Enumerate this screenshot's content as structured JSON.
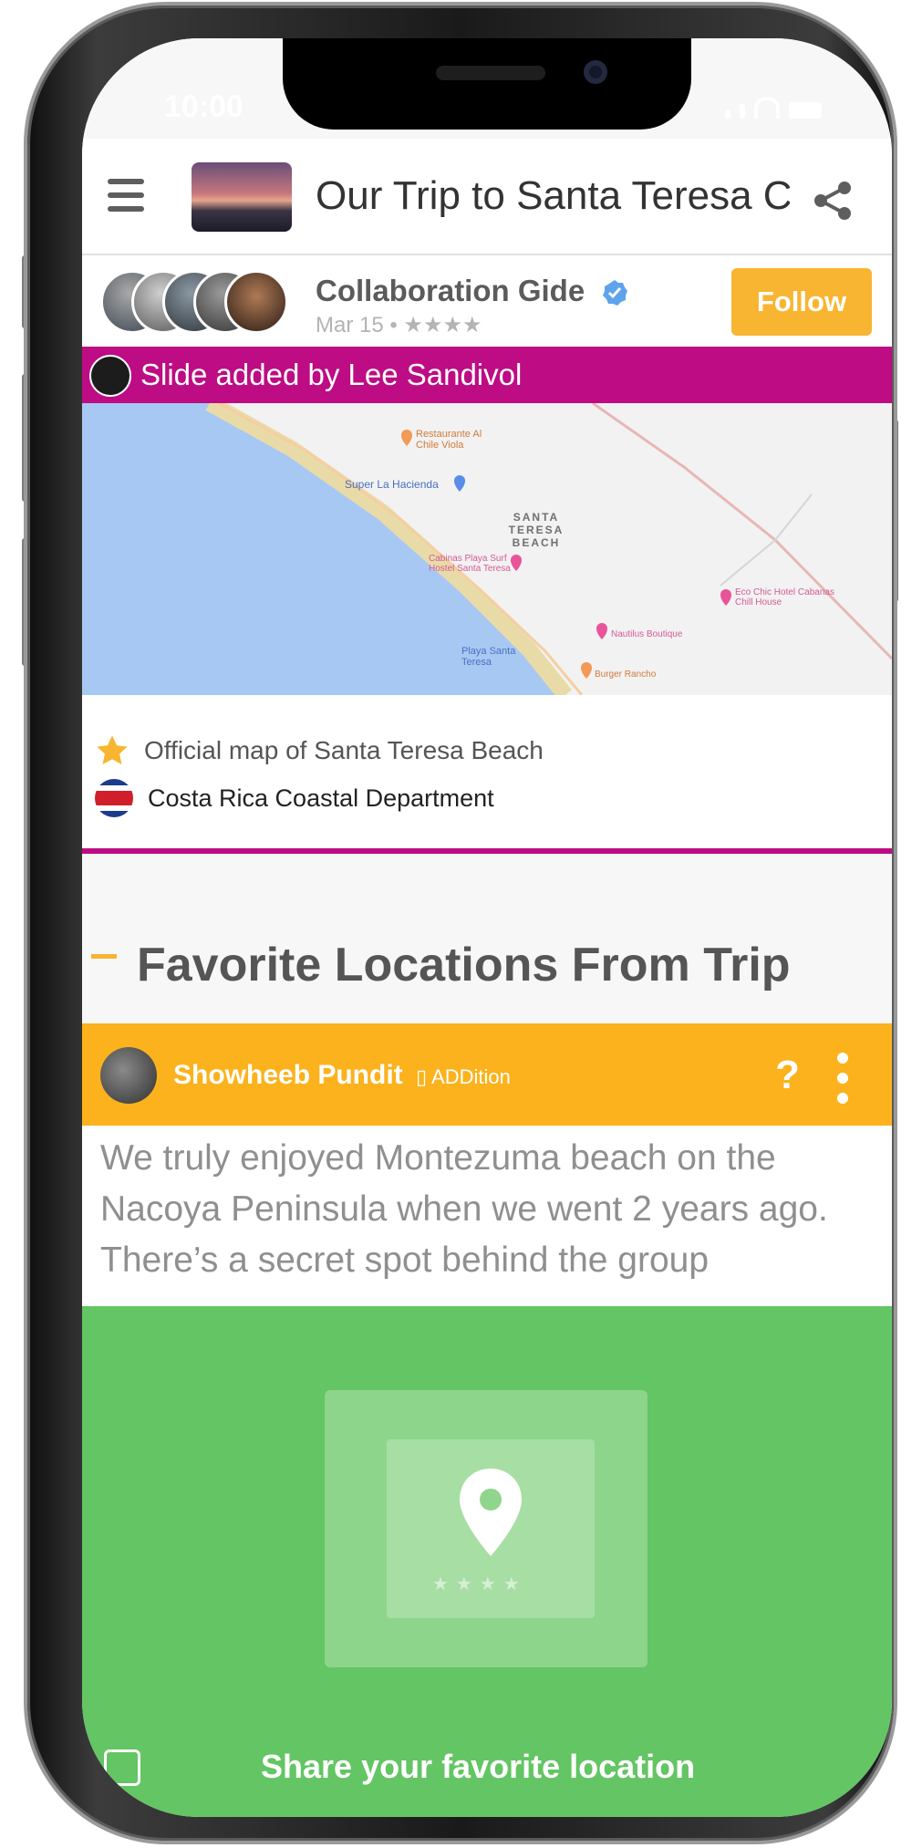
{
  "status_bar": {
    "time": "10:00"
  },
  "header": {
    "title": "Our Trip to Santa Teresa C..."
  },
  "author": {
    "name": "Collaboration Gide",
    "meta": "Mar 15 • ★★★★",
    "follow_label": "Follow"
  },
  "slide_banner": {
    "text": "Slide added by Lee Sandivol"
  },
  "map": {
    "labels": [
      "Restaurante Al Chile Viola",
      "Super La Hacienda",
      "SANTA TERESA BEACH",
      "Cabinas Playa Surf Hostel Santa Teresa",
      "Eco Chic Hotel Cabanas Chill House",
      "Nautilus Boutique",
      "Playa Santa Teresa",
      "Burger Rancho"
    ]
  },
  "source": {
    "official": "Official map of Santa Teresa Beach",
    "department": "Costa Rica Coastal Department"
  },
  "section": {
    "title": "Favorite Locations From Trip"
  },
  "comment": {
    "author": "Showheeb Pundit",
    "tag": "▯ ADDition",
    "help": "?",
    "text": "We truly enjoyed Montezuma beach on the Nacoya Peninsula when we went 2 years ago. There’s a secret spot behind the group"
  },
  "share_panel": {
    "stars": "★★★★",
    "label": "Share your favorite location"
  },
  "colors": {
    "accent_magenta": "#bd0c84",
    "accent_yellow": "#fbb21c",
    "share_green": "#63c563"
  }
}
